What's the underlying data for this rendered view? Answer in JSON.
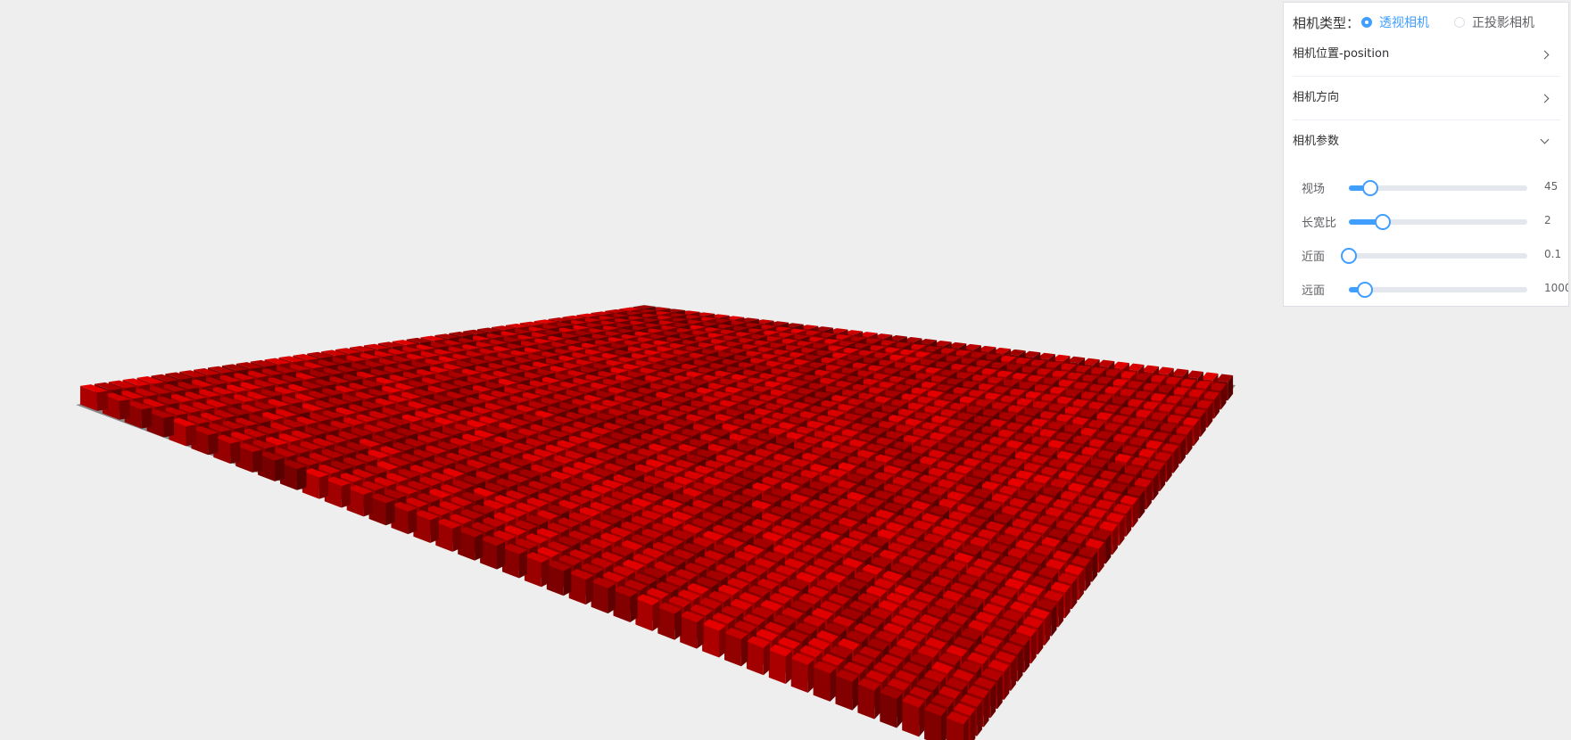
{
  "scene": {
    "background": "#eeeeee",
    "ground_color": "#888888",
    "cube_color": "#cc0000",
    "grid": {
      "rows": 40,
      "cols": 40
    }
  },
  "panel": {
    "camera_type_label": "相机类型：",
    "camera_types": [
      {
        "label": "透视相机",
        "checked": true
      },
      {
        "label": "正投影相机",
        "checked": false
      }
    ],
    "sections": [
      {
        "title": "相机位置-position",
        "expanded": false,
        "icon": "chevron-right-icon"
      },
      {
        "title": "相机方向",
        "expanded": false,
        "icon": "chevron-right-icon"
      },
      {
        "title": "相机参数",
        "expanded": true,
        "icon": "chevron-down-icon"
      }
    ],
    "params": [
      {
        "label": "视场",
        "value": "45",
        "level": 0.12
      },
      {
        "label": "长宽比",
        "value": "2",
        "level": 0.19
      },
      {
        "label": "近面",
        "value": "0.1",
        "level": 0.0
      },
      {
        "label": "远面",
        "value": "1000",
        "level": 0.09
      }
    ]
  },
  "colors": {
    "accent": "#409eff",
    "border": "#dcdfe6",
    "divider": "#ebeef5"
  }
}
